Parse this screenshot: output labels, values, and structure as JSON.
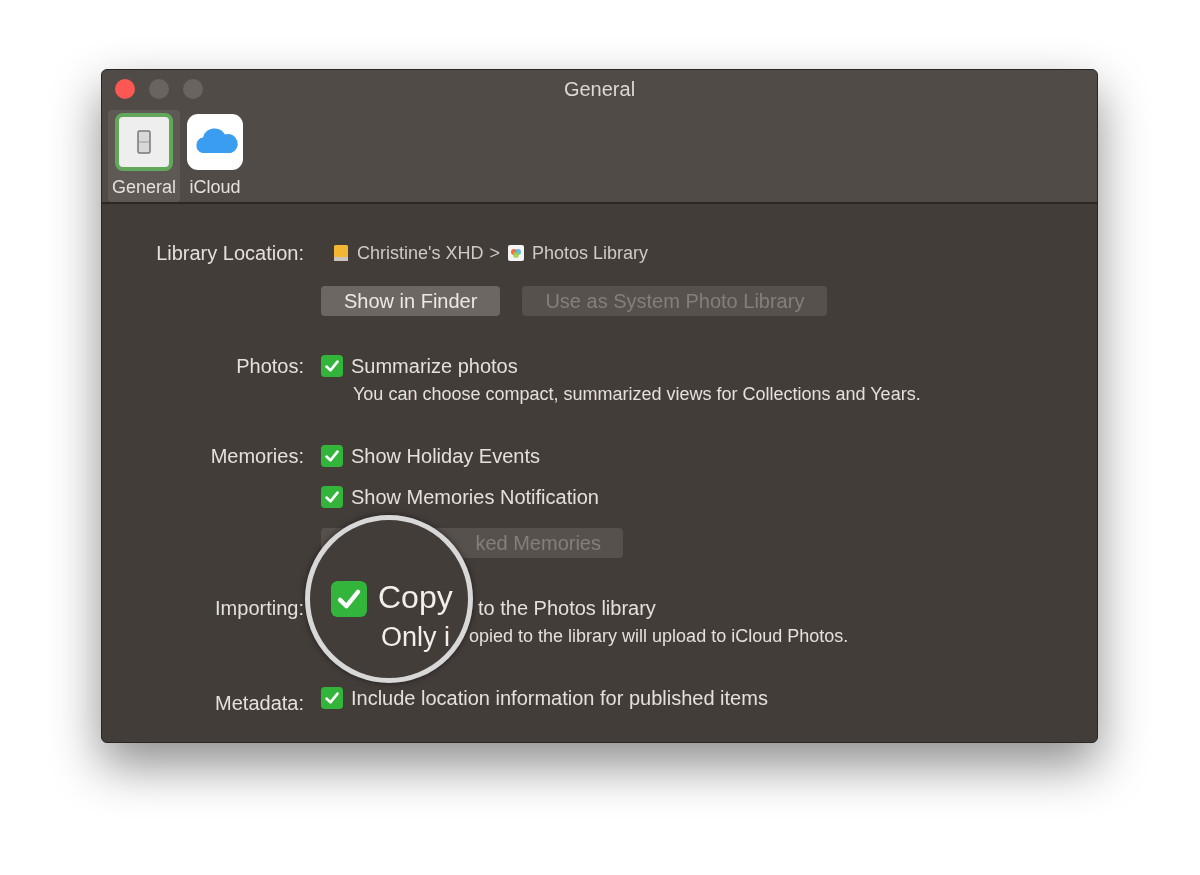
{
  "window": {
    "title": "General"
  },
  "toolbar": [
    {
      "label": "General",
      "kind": "general",
      "selected": true
    },
    {
      "label": "iCloud",
      "kind": "icloud",
      "selected": false
    }
  ],
  "sections": [
    {
      "label": "Library Location:",
      "rows": [
        {
          "kind": "path",
          "separator": ">",
          "items": [
            {
              "kind": "drive",
              "name": "Christine's XHD"
            },
            {
              "kind": "library",
              "name": "Photos Library"
            }
          ]
        },
        {
          "kind": "buttons",
          "buttons": [
            {
              "label": "Show in Finder",
              "disabled": false
            },
            {
              "label": "Use as System Photo Library",
              "disabled": true
            }
          ]
        }
      ]
    },
    {
      "label": "Photos:",
      "rows": [
        {
          "kind": "checkbox",
          "label": "Summarize photos",
          "checked": true,
          "note": "You can choose compact, summarized views for Collections and Years."
        }
      ]
    },
    {
      "label": "Memories:",
      "rows": [
        {
          "kind": "checkbox",
          "label": "Show Holiday Events",
          "checked": true
        },
        {
          "kind": "checkbox",
          "label": "Show Memories Notification",
          "checked": true
        },
        {
          "kind": "partial-button",
          "label": "ked Memories",
          "disabled": true
        }
      ]
    },
    {
      "label": "Importing:",
      "rows": [
        {
          "kind": "covered",
          "label": "to the Photos library",
          "note": "opied to the library will upload to iCloud Photos."
        }
      ]
    },
    {
      "label": "Metadata:",
      "rows": [
        {
          "kind": "checkbox",
          "label": "Include location information for published items",
          "checked": true
        }
      ]
    }
  ],
  "magnifier": {
    "checked": true,
    "label": "Copy",
    "note": "Only i"
  }
}
